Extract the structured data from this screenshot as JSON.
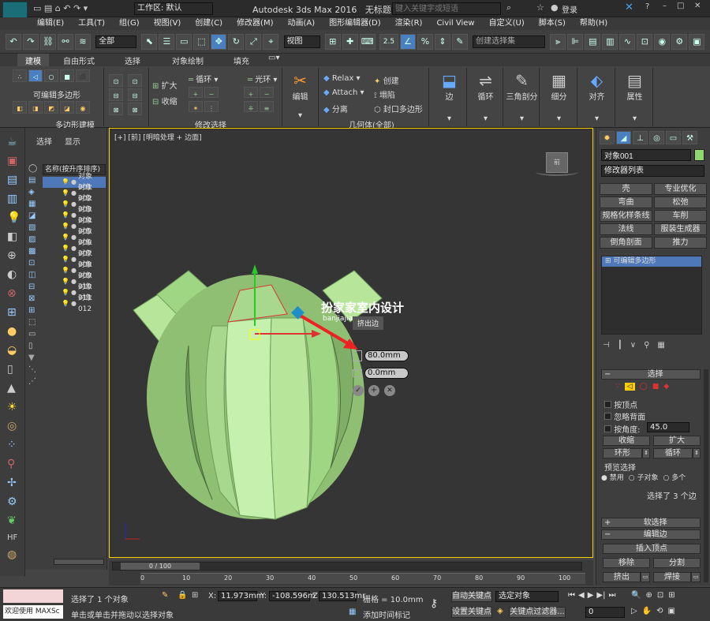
{
  "title": {
    "app": "Autodesk 3ds Max 2016",
    "doc": "无标题",
    "workspace": "工作区: 默认",
    "search_placeholder": "键入关键字或短语",
    "login": "登录"
  },
  "menus": [
    "编辑(E)",
    "工具(T)",
    "组(G)",
    "视图(V)",
    "创建(C)",
    "修改器(M)",
    "动画(A)",
    "图形编辑器(D)",
    "渲染(R)",
    "Civil View",
    "自定义(U)",
    "脚本(S)",
    "帮助(H)"
  ],
  "toolbar": {
    "filter": "全部",
    "view": "视图",
    "snap": "2.5",
    "selset_placeholder": "创建选择集"
  },
  "ribbon_tabs": [
    "建模",
    "自由形式",
    "选择",
    "对象绘制",
    "填充"
  ],
  "ribbon": {
    "g1_label": "可编辑多边形",
    "g1_title": "多边形建模",
    "g2_title": "修改选择",
    "g2_expand": "扩大",
    "g2_shrink": "收缩",
    "g2_loop": "循环",
    "g2_ring": "光环",
    "edit": "编辑",
    "g3_title": "几何体(全部)",
    "relax": "Relax",
    "attach": "Attach",
    "detach": "分离",
    "create": "创建",
    "collapse": "塌陷",
    "cap": "封口多边形",
    "edge": "边",
    "loop": "循环",
    "tri": "三角剖分",
    "subdiv": "细分",
    "align": "对齐",
    "props": "属性"
  },
  "scene": {
    "tab_select": "选择",
    "tab_display": "显示",
    "header": "名称(按升序排序)",
    "items": [
      "对象001",
      "对象002",
      "对象003",
      "对象004",
      "对象005",
      "对象006",
      "对象007",
      "对象008",
      "对象009",
      "对象010",
      "对象011",
      "对象012"
    ]
  },
  "viewport": {
    "label": "[+] [前] [明暗处理 + 边面]",
    "watermark_cn": "扮家家室内设计",
    "watermark_url": "banjiajia.com",
    "caddy_title": "挤出边",
    "caddy_height": "80.0mm",
    "caddy_width": "0.0mm"
  },
  "cmd": {
    "object_name": "对象001",
    "modifier_list": "修改器列表",
    "mods": [
      "壳",
      "专业优化",
      "弯曲",
      "松弛",
      "规格化样条线",
      "车削",
      "法线",
      "服装生成器",
      "倒角剖面",
      "推力"
    ],
    "stack_item": "可编辑多边形",
    "sel_title": "选择",
    "by_vertex": "按顶点",
    "ignore_back": "忽略背面",
    "by_angle": "按角度:",
    "angle": "45.0",
    "shrink": "收缩",
    "grow": "扩大",
    "ring": "环形",
    "loop": "循环",
    "preview": "预览选择",
    "disable": "禁用",
    "subobj": "子对象",
    "multi": "多个",
    "sel_count": "选择了 3 个边",
    "soft": "软选择",
    "edit_edge": "编辑边",
    "insert_vertex": "插入顶点",
    "remove": "移除",
    "split": "分割",
    "extrude": "挤出",
    "weld": "焊接"
  },
  "timeline": {
    "frame": "0 / 100",
    "ticks": [
      "0",
      "10",
      "20",
      "30",
      "40",
      "50",
      "60",
      "70",
      "80",
      "90",
      "100"
    ]
  },
  "status": {
    "welcome": "欢迎使用 MAXSc",
    "sel": "选择了 1 个对象",
    "hint": "单击或单击并拖动以选择对象",
    "x": "11.973mm",
    "y": "-108.596m",
    "z": "130.513mr",
    "grid": "栅格 = 10.0mm",
    "autokey": "自动关键点",
    "selobj": "选定对象",
    "setkey": "设置关键点",
    "keyfilter": "关键点过滤器...",
    "addtime": "添加时间标记",
    "frame": "0"
  }
}
